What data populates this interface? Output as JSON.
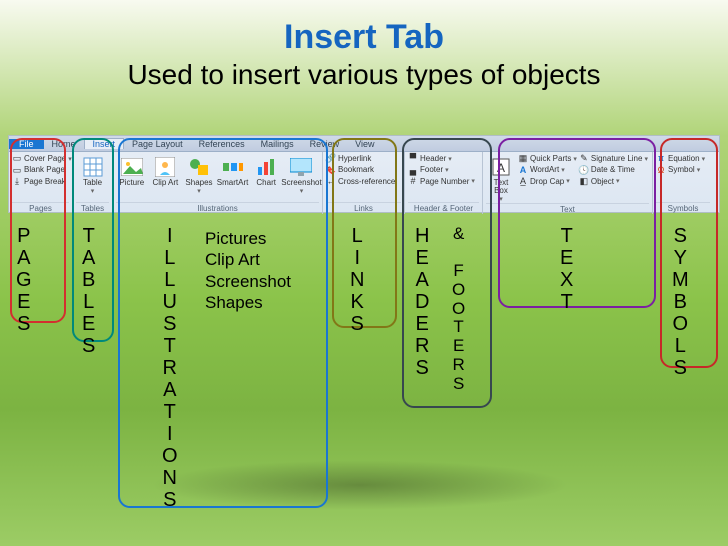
{
  "title": "Insert Tab",
  "subtitle": "Used to insert various types of objects",
  "tabs": {
    "file": "File",
    "home": "Home",
    "insert": "Insert",
    "layout": "Page Layout",
    "refs": "References",
    "mail": "Mailings",
    "review": "Review",
    "view": "View"
  },
  "ribbon": {
    "pages": {
      "label": "Pages",
      "cover": "Cover Page",
      "blank": "Blank Page",
      "break": "Page Break"
    },
    "tables": {
      "label": "Tables",
      "btn": "Table"
    },
    "illus": {
      "label": "Illustrations",
      "pic": "Picture",
      "clip": "Clip Art",
      "shapes": "Shapes",
      "smart": "SmartArt",
      "chart": "Chart",
      "screen": "Screenshot"
    },
    "links": {
      "label": "Links",
      "hyper": "Hyperlink",
      "book": "Bookmark",
      "cross": "Cross-reference"
    },
    "hf": {
      "label": "Header & Footer",
      "header": "Header",
      "footer": "Footer",
      "page": "Page Number"
    },
    "text": {
      "label": "Text",
      "box": "Text Box",
      "quick": "Quick Parts",
      "wordart": "WordArt",
      "drop": "Drop Cap",
      "sig": "Signature Line",
      "date": "Date & Time",
      "obj": "Object"
    },
    "sym": {
      "label": "Symbols",
      "eq": "Equation",
      "sy": "Symbol"
    }
  },
  "callouts": {
    "pages": "PAGES",
    "tables": "TABLES",
    "illus": "ILLUSTRATIONS",
    "links": "LINKS",
    "hf1": "HEADERS",
    "hf2": "& FOOTERS",
    "text": "TEXT",
    "sym": "SYMBOLS",
    "sublist": [
      "Pictures",
      "Clip Art",
      "Screenshot",
      "Shapes"
    ]
  }
}
